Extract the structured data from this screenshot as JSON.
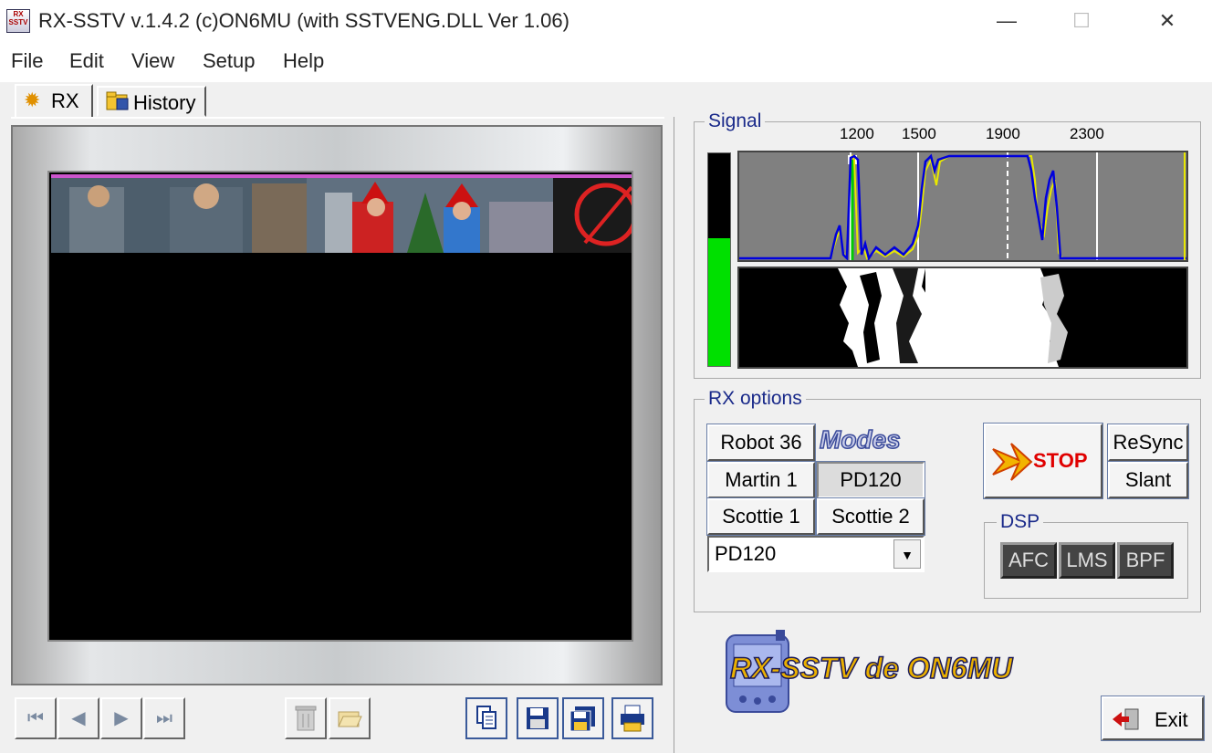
{
  "window": {
    "title": "RX-SSTV v.1.4.2 (c)ON6MU (with SSTVENG.DLL Ver 1.06)",
    "icon_text": "RX SSTV",
    "minimize_glyph": "—",
    "maximize_glyph": "☐",
    "close_glyph": "✕"
  },
  "menu": [
    "File",
    "Edit",
    "View",
    "Setup",
    "Help"
  ],
  "tabs": [
    {
      "label": "RX",
      "icon": "gear-icon",
      "active": true
    },
    {
      "label": "History",
      "icon": "folder-icon",
      "active": false
    }
  ],
  "nav_glyphs": {
    "first": "⏮",
    "prev": "◀",
    "next": "▶",
    "last": "⏭"
  },
  "signal": {
    "title": "Signal",
    "freq_labels": [
      "1200",
      "1500",
      "1900",
      "2300"
    ],
    "level_fraction": 0.6
  },
  "rx_options": {
    "title": "RX options",
    "modes_label": "Modes",
    "mode_buttons": [
      "Robot 36",
      "Martin 1",
      "PD120",
      "Scottie 1",
      "Scottie 2"
    ],
    "active_mode": "PD120",
    "selected_mode": "PD120",
    "stop_label": "STOP",
    "resync_label": "ReSync",
    "slant_label": "Slant",
    "dsp_title": "DSP",
    "dsp_buttons": [
      "AFC",
      "LMS",
      "BPF"
    ]
  },
  "logo_text": "RX-SSTV de ON6MU",
  "exit_label": "Exit",
  "colors": {
    "level": "#00e000",
    "trace_blue": "#0000dd",
    "trace_yellow": "#e8e800",
    "group_title": "#1a2a8a",
    "stop_text": "#e00000"
  }
}
